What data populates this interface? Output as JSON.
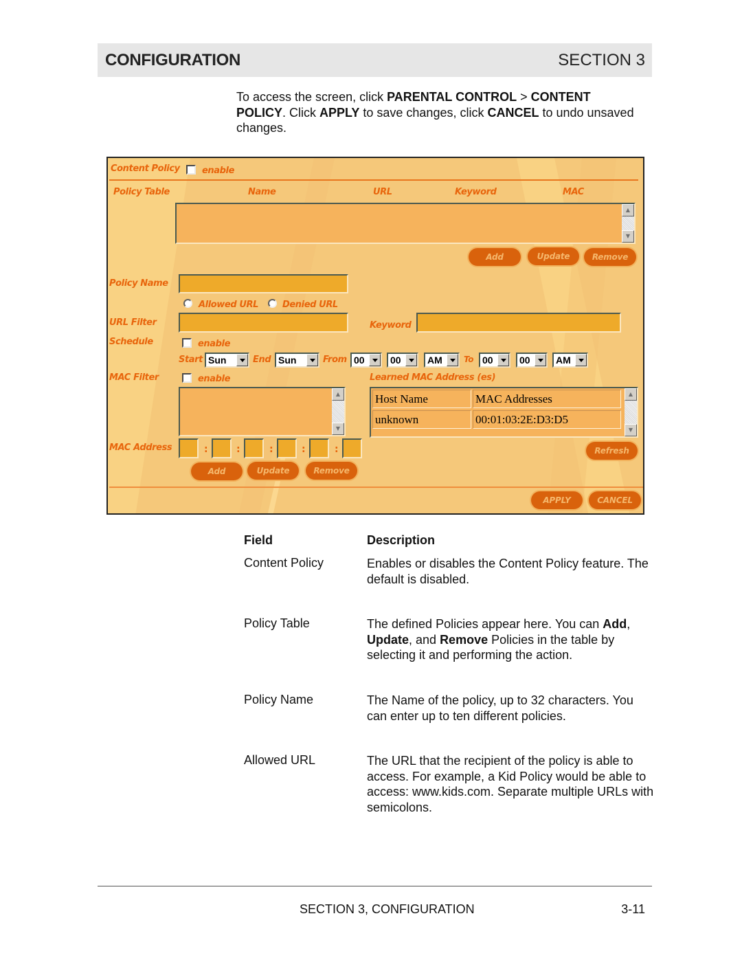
{
  "header": {
    "left": "CONFIGURATION",
    "right": "SECTION 3"
  },
  "intro": {
    "t1": "To access the screen, click ",
    "b1": "PARENTAL CONTROL",
    "t2": " > ",
    "b2": "CONTENT POLICY",
    "t3": ". Click ",
    "b3": "APPLY",
    "t4": " to save changes, click ",
    "b4": "CANCEL",
    "t5": " to undo unsaved changes."
  },
  "ui": {
    "content_policy_label": "Content Policy",
    "content_policy_enable": "enable",
    "content_policy_checked": false,
    "policy_table": {
      "label": "Policy Table",
      "columns": [
        "Name",
        "URL",
        "Keyword",
        "MAC"
      ],
      "rows": []
    },
    "table_buttons": {
      "add": "Add",
      "update": "Update",
      "remove": "Remove"
    },
    "policy_name_label": "Policy Name",
    "policy_name_value": "",
    "url_mode": {
      "allowed": "Allowed URL",
      "denied": "Denied URL",
      "selected": null
    },
    "url_filter_label": "URL Filter",
    "url_filter_value": "",
    "keyword_label": "Keyword",
    "keyword_value": "",
    "schedule_label": "Schedule",
    "schedule_enable": "enable",
    "schedule_checked": false,
    "start_label": "Start",
    "start_value": "Sun",
    "end_label": "End",
    "end_value": "Sun",
    "from_label": "From",
    "from_hour": "00",
    "from_min": "00",
    "from_ampm": "AM",
    "to_label": "To",
    "to_hour": "00",
    "to_min": "00",
    "to_ampm": "AM",
    "mac_filter_label": "MAC Filter",
    "mac_filter_enable": "enable",
    "mac_filter_checked": false,
    "learned_mac_label": "Learned MAC Address (es)",
    "learned_mac_table": {
      "columns": [
        "Host Name",
        "MAC Addresses"
      ],
      "rows": [
        [
          "unknown",
          "00:01:03:2E:D3:D5"
        ]
      ]
    },
    "refresh_button": "Refresh",
    "mac_address_label": "MAC Address",
    "mac_octets": [
      "",
      "",
      "",
      "",
      "",
      ""
    ],
    "mac_separator": ":",
    "mac_buttons": {
      "add": "Add",
      "update": "Update",
      "remove": "Remove"
    },
    "apply_button": "APPLY",
    "cancel_button": "CANCEL"
  },
  "description_table": {
    "header_field": "Field",
    "header_description": "Description",
    "rows": [
      {
        "field": "Content Policy",
        "description": "Enables or disables the Content Policy feature. The default is disabled."
      },
      {
        "field": "Policy Table",
        "d1": "The defined Policies appear here. You can ",
        "b1": "Add",
        "d2": ", ",
        "b2": "Update",
        "d3": ", and ",
        "b3": "Remove",
        "d4": " Policies in the table by selecting it and performing the action."
      },
      {
        "field": "Policy Name",
        "description": "The Name of the policy, up to 32 characters. You can enter up to ten different policies."
      },
      {
        "field": "Allowed URL",
        "description": "The URL that the recipient of the policy is able to access. For example, a Kid Policy would be able to access: www.kids.com. Separate multiple URLs with semicolons."
      }
    ]
  },
  "footer": {
    "center": "SECTION 3, CONFIGURATION",
    "page": "3-11"
  },
  "colors": {
    "ui_background": "#f5c87a",
    "label_orange": "#e8650c",
    "button_orange": "#d9620c",
    "field_fill": "#eeaa2a",
    "list_fill": "#f6b35c"
  }
}
